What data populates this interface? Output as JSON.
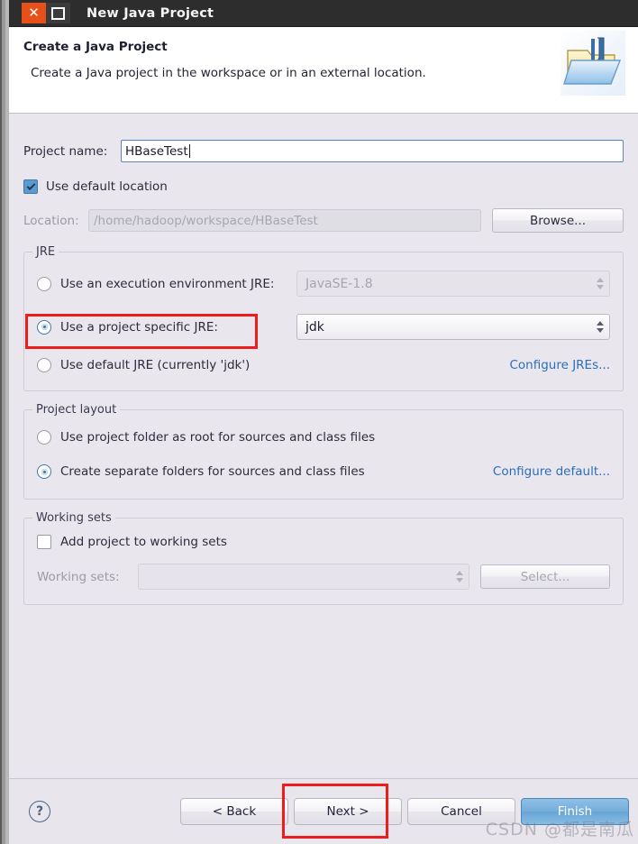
{
  "window": {
    "title": "New Java Project",
    "close_label": "✕",
    "maximize_label": ""
  },
  "header": {
    "title": "Create a Java Project",
    "subtitle": "Create a Java project in the workspace or in an external location.",
    "icon": "java-project-folder-icon"
  },
  "project": {
    "name_label": "Project name:",
    "name_value": "HBaseTest",
    "use_default_location_label": "Use default location",
    "use_default_location_checked": true,
    "location_label": "Location:",
    "location_value": "/home/hadoop/workspace/HBaseTest",
    "browse_label": "Browse..."
  },
  "jre": {
    "legend": "JRE",
    "execution_env_label": "Use an execution environment JRE:",
    "execution_env_value": "JavaSE-1.8",
    "execution_env_selected": false,
    "project_specific_label": "Use a project specific JRE:",
    "project_specific_value": "jdk",
    "project_specific_selected": true,
    "default_jre_label": "Use default JRE (currently 'jdk')",
    "default_jre_selected": false,
    "configure_link": "Configure JREs..."
  },
  "layout": {
    "legend": "Project layout",
    "root_folder_label": "Use project folder as root for sources and class files",
    "root_folder_selected": false,
    "separate_folders_label": "Create separate folders for sources and class files",
    "separate_folders_selected": true,
    "configure_link": "Configure default..."
  },
  "working_sets": {
    "legend": "Working sets",
    "add_label": "Add project to working sets",
    "add_checked": false,
    "sets_label": "Working sets:",
    "sets_value": "",
    "select_label": "Select..."
  },
  "footer": {
    "help_label": "?",
    "back_label": "< Back",
    "next_label": "Next >",
    "cancel_label": "Cancel",
    "finish_label": "Finish"
  },
  "annotations": {
    "accent_color": "#ef1c1c",
    "targets": [
      "Use a project specific JRE:",
      "Next >"
    ]
  },
  "watermark": {
    "text": "CSDN @都是南瓜"
  }
}
